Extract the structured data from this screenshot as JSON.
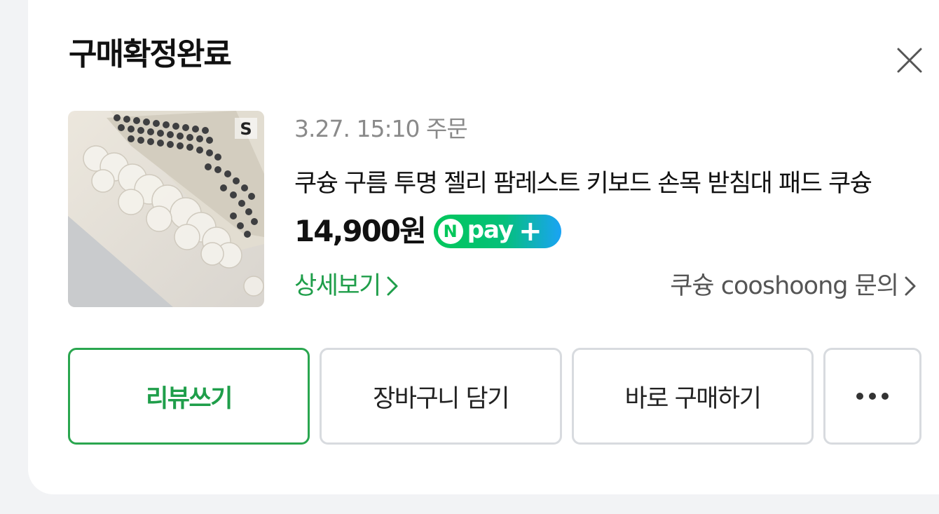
{
  "header": {
    "title": "구매확정완료"
  },
  "order": {
    "date_text": "3.27. 15:10 주문",
    "product_name": "쿠슝 구름 투명 젤리 팜레스트 키보드 손목 받침대 패드 쿠슝",
    "price": "14,900원",
    "payment_badge": {
      "n_letter": "N",
      "label": "pay",
      "plus": "+"
    },
    "detail_link": "상세보기",
    "seller_link": "쿠슝 cooshoong 문의"
  },
  "actions": {
    "review": "리뷰쓰기",
    "add_to_cart": "장바구니 담기",
    "buy_now": "바로 구매하기"
  },
  "colors": {
    "accent_green": "#1f9e4a",
    "button_border": "#d8dbdf",
    "npay_green": "#03c75a",
    "npay_blue": "#1aa3f5"
  },
  "icons": {
    "close": "close-icon",
    "chevron": "chevron-right-icon",
    "more": "more-dots-icon"
  }
}
